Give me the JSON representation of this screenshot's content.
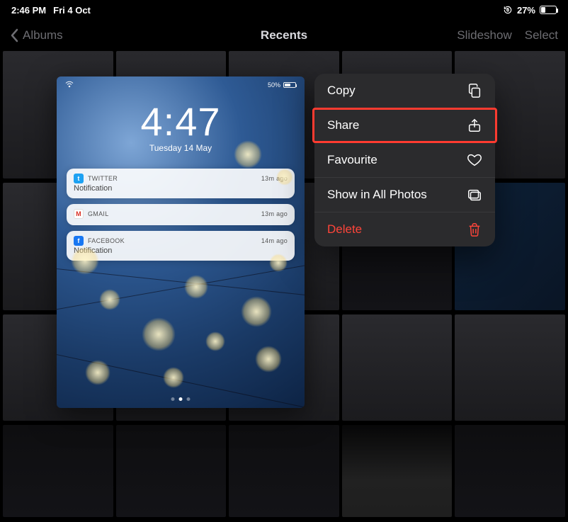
{
  "status": {
    "time": "2:46 PM",
    "date": "Fri 4 Oct",
    "battery_pct": "27%"
  },
  "nav": {
    "back_label": "Albums",
    "title": "Recents",
    "slideshow": "Slideshow",
    "select": "Select"
  },
  "preview": {
    "mini_status": {
      "wifi": "●",
      "batt": "50%"
    },
    "clock_time": "4:47",
    "clock_date": "Tuesday 14 May",
    "notifs": [
      {
        "app": "TWITTER",
        "icon_class": "tw",
        "glyph": "t",
        "age": "13m ago",
        "body": "Notification"
      },
      {
        "app": "GMAIL",
        "icon_class": "gm",
        "glyph": "M",
        "age": "13m ago",
        "body": ""
      },
      {
        "app": "FACEBOOK",
        "icon_class": "fb",
        "glyph": "f",
        "age": "14m ago",
        "body": "Notification"
      }
    ]
  },
  "menu": {
    "items": [
      {
        "label": "Copy",
        "icon": "copy-icon",
        "destructive": false
      },
      {
        "label": "Share",
        "icon": "share-icon",
        "destructive": false,
        "highlighted": true
      },
      {
        "label": "Favourite",
        "icon": "heart-icon",
        "destructive": false
      },
      {
        "label": "Show in All Photos",
        "icon": "photos-icon",
        "destructive": false
      },
      {
        "label": "Delete",
        "icon": "trash-icon",
        "destructive": true
      }
    ]
  },
  "colors": {
    "destructive": "#ff453a",
    "menu_bg": "#2b2b2d",
    "highlight": "#ff3b30"
  }
}
